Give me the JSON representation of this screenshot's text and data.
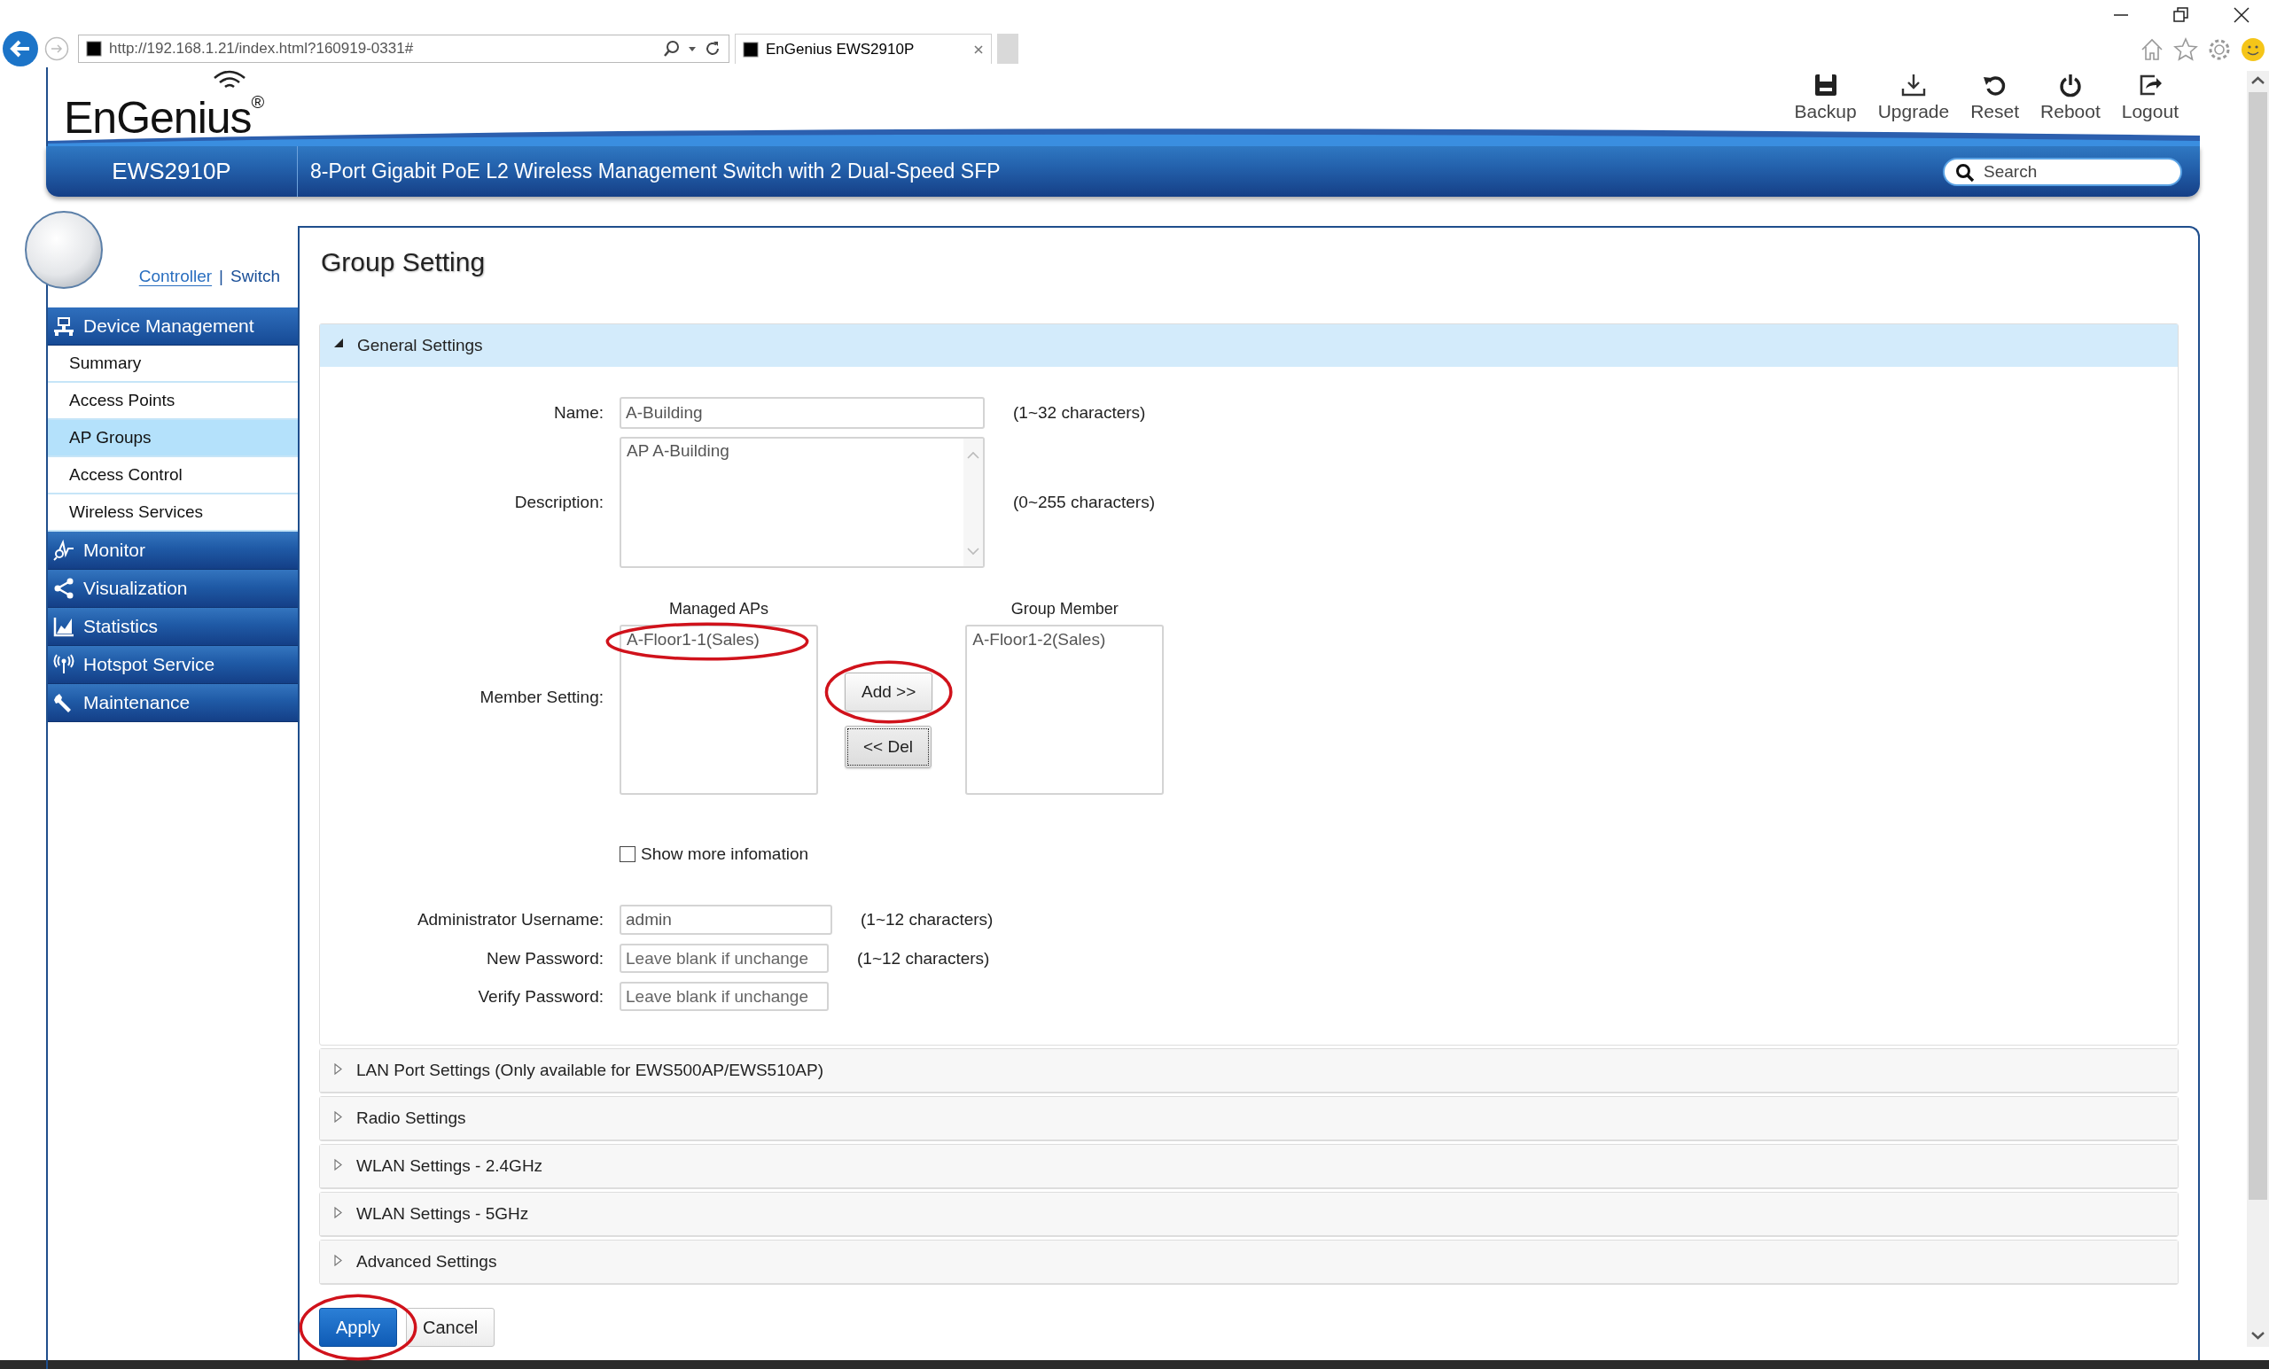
{
  "browser": {
    "url": "http://192.168.1.21/index.html?160919-0331#",
    "tab_title": "EnGenius EWS2910P"
  },
  "header": {
    "logo": "EnGenius$^{®}$",
    "tools": [
      {
        "kind": "backup",
        "label": "Backup"
      },
      {
        "kind": "upgrade",
        "label": "Upgrade"
      },
      {
        "kind": "reset",
        "label": "Reset"
      },
      {
        "kind": "reboot",
        "label": "Reboot"
      },
      {
        "kind": "logout",
        "label": "Logout"
      }
    ],
    "model": "EWS2910P",
    "description": "8-Port Gigabit PoE L2 Wireless Management Switch with 2 Dual-Speed SFP",
    "search": {
      "placeholder": "Search"
    }
  },
  "sidebar": {
    "modes": [
      {
        "label": "Controller",
        "selected": true
      },
      {
        "label": "Switch",
        "selected": false
      }
    ],
    "separator": "|",
    "sections": [
      {
        "kind": "device",
        "label": "Device Management",
        "expanded": true,
        "items": [
          {
            "label": "Summary",
            "selected": false
          },
          {
            "label": "Access Points",
            "selected": false
          },
          {
            "label": "AP Groups",
            "selected": true
          },
          {
            "label": "Access Control",
            "selected": false
          },
          {
            "label": "Wireless Services",
            "selected": false
          }
        ]
      },
      {
        "kind": "monitor",
        "label": "Monitor",
        "expanded": false
      },
      {
        "kind": "visualization",
        "label": "Visualization",
        "expanded": false
      },
      {
        "kind": "statistics",
        "label": "Statistics",
        "expanded": false
      },
      {
        "kind": "hotspot",
        "label": "Hotspot Service",
        "expanded": false
      },
      {
        "kind": "maintenance",
        "label": "Maintenance",
        "expanded": false
      }
    ]
  },
  "page": {
    "title": "Group Setting",
    "panels": [
      {
        "title": "General Settings",
        "expanded": true,
        "fields": [
          {
            "kind": "text",
            "label": "Name:",
            "value": "A-Building",
            "hint": "(1~32 characters)"
          },
          {
            "kind": "textarea",
            "label": "Description:",
            "value": "AP A-Building",
            "hint": "(0~255 characters)"
          },
          {
            "kind": "members",
            "label": "Member Setting:",
            "available": {
              "title": "Managed APs",
              "items": [
                {
                  "label": "A-Floor1-1(Sales)",
                  "highlighted": true
                }
              ]
            },
            "add": {
              "label": "Add >>",
              "highlighted": true,
              "focused": false
            },
            "remove": {
              "label": "<< Del",
              "highlighted": false,
              "focused": true
            },
            "members": {
              "title": "Group Member",
              "items": [
                {
                  "label": "A-Floor1-2(Sales)",
                  "highlighted": false
                }
              ]
            }
          },
          {
            "kind": "checkbox",
            "label": "Show more infomation",
            "checked": false
          },
          {
            "kind": "text",
            "label": "Administrator Username:",
            "value": "admin",
            "hint": "(1~12 characters)"
          },
          {
            "kind": "password",
            "label": "New Password:",
            "placeholder": "Leave blank if unchange",
            "hint": "(1~12 characters)"
          },
          {
            "kind": "password",
            "label": "Verify Password:",
            "placeholder": "Leave blank if unchange"
          }
        ]
      },
      {
        "title": "LAN Port Settings (Only available for EWS500AP/EWS510AP)",
        "expanded": false
      },
      {
        "title": "Radio Settings",
        "expanded": false
      },
      {
        "title": "WLAN Settings - 2.4GHz",
        "expanded": false
      },
      {
        "title": "WLAN Settings - 5GHz",
        "expanded": false
      },
      {
        "title": "Advanced Settings",
        "expanded": false
      }
    ],
    "actions": [
      {
        "kind": "primary",
        "label": "Apply",
        "highlighted": true
      },
      {
        "kind": "secondary",
        "label": "Cancel",
        "highlighted": false
      }
    ]
  }
}
